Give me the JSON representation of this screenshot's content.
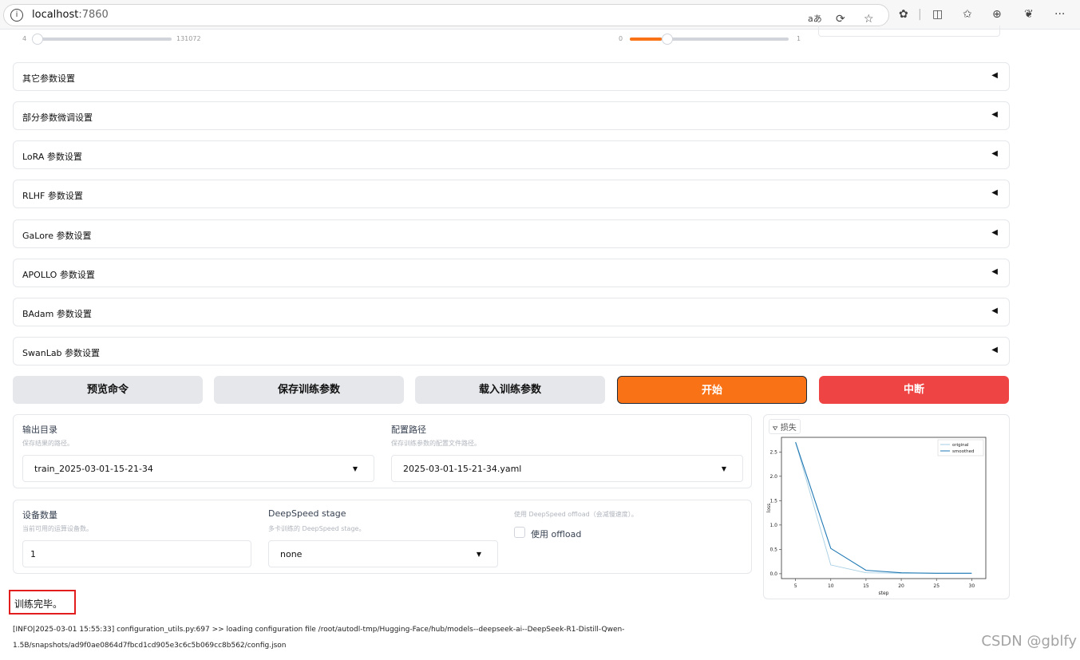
{
  "browser": {
    "url_host": "localhost",
    "url_port": ":7860",
    "icons": [
      "translate-icon",
      "refresh-icon",
      "star-icon",
      "extensions-icon",
      "split-screen-icon",
      "favorites-icon",
      "collections-icon",
      "copilot-icon",
      "more-icon"
    ]
  },
  "sliders": {
    "left_min": "4",
    "left_max": "131072",
    "right_min": "0",
    "right_max": "1",
    "right_level": 0.1
  },
  "accordions": [
    {
      "label": "其它参数设置",
      "arrow": "◀"
    },
    {
      "label": "部分参数微调设置",
      "arrow": "◀"
    },
    {
      "label": "LoRA 参数设置",
      "arrow": "◀"
    },
    {
      "label": "RLHF 参数设置",
      "arrow": "◀"
    },
    {
      "label": "GaLore 参数设置",
      "arrow": "◀"
    },
    {
      "label": "APOLLO 参数设置",
      "arrow": "◀"
    },
    {
      "label": "BAdam 参数设置",
      "arrow": "◀"
    },
    {
      "label": "SwanLab 参数设置",
      "arrow": "◀"
    }
  ],
  "actions": {
    "preview": "预览命令",
    "save": "保存训练参数",
    "load": "载入训练参数",
    "start": "开始",
    "stop": "中断"
  },
  "output": {
    "dir_label": "输出目录",
    "dir_info": "保存结果的路径。",
    "dir_value": "train_2025-03-01-15-21-34",
    "config_label": "配置路径",
    "config_info": "保存训练参数的配置文件路径。",
    "config_value": "2025-03-01-15-21-34.yaml",
    "caret": "▼"
  },
  "devices": {
    "count_label": "设备数量",
    "count_info": "当前可用的运算设备数。",
    "count_value": "1",
    "ds_label": "DeepSpeed stage",
    "ds_info": "多卡训练的 DeepSpeed stage。",
    "ds_value": "none",
    "offload_info": "使用 DeepSpeed offload（会减慢速度）。",
    "offload_label": "使用 offload"
  },
  "chart_tab": "⦡ 损失",
  "chart_data": {
    "type": "line",
    "xlabel": "step",
    "ylabel": "loss",
    "xlim": [
      3,
      32
    ],
    "ylim": [
      -0.1,
      2.8
    ],
    "xticks": [
      5,
      10,
      15,
      20,
      25,
      30
    ],
    "yticks": [
      0.0,
      0.5,
      1.0,
      1.5,
      2.0,
      2.5
    ],
    "legend": "top-right",
    "series": [
      {
        "name": "original",
        "color": "#a6cee3",
        "x": [
          5,
          10,
          15,
          20,
          25,
          30
        ],
        "y": [
          2.7,
          0.18,
          0.02,
          0.01,
          0.01,
          0.01
        ]
      },
      {
        "name": "smoothed",
        "color": "#1f78b4",
        "x": [
          5,
          10,
          15,
          20,
          25,
          30
        ],
        "y": [
          2.7,
          0.52,
          0.07,
          0.02,
          0.01,
          0.01
        ]
      }
    ]
  },
  "status": {
    "message": "训练完毕。",
    "log_line1": "[INFO|2025-03-01 15:55:33] configuration_utils.py:697 >> loading configuration file /root/autodl-tmp/Hugging-Face/hub/models--deepseek-ai--DeepSeek-R1-Distill-Qwen-",
    "log_line2": "1.5B/snapshots/ad9f0ae0864d7fbcd1cd905e3c6c5b069cc8b562/config.json"
  },
  "watermark": "CSDN @gblfy"
}
